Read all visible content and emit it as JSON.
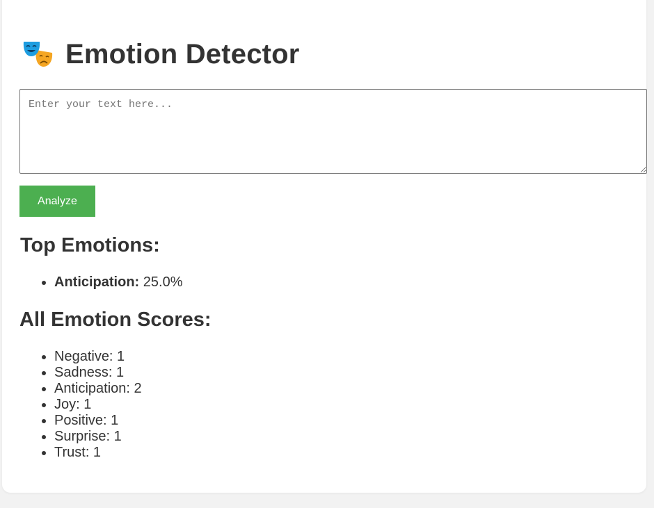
{
  "app": {
    "title": "Emotion Detector",
    "icon": "theater-masks-icon"
  },
  "input": {
    "value": "",
    "placeholder": "Enter your text here..."
  },
  "analyze_button": {
    "label": "Analyze",
    "color": "#4caf50"
  },
  "top_emotions": {
    "heading": "Top Emotions:",
    "items": [
      {
        "label": "Anticipation:",
        "value": "25.0%"
      }
    ]
  },
  "all_scores": {
    "heading": "All Emotion Scores:",
    "items": [
      {
        "text": "Negative: 1"
      },
      {
        "text": "Sadness: 1"
      },
      {
        "text": "Anticipation: 2"
      },
      {
        "text": "Joy: 1"
      },
      {
        "text": "Positive: 1"
      },
      {
        "text": "Surprise: 1"
      },
      {
        "text": "Trust: 1"
      }
    ]
  }
}
